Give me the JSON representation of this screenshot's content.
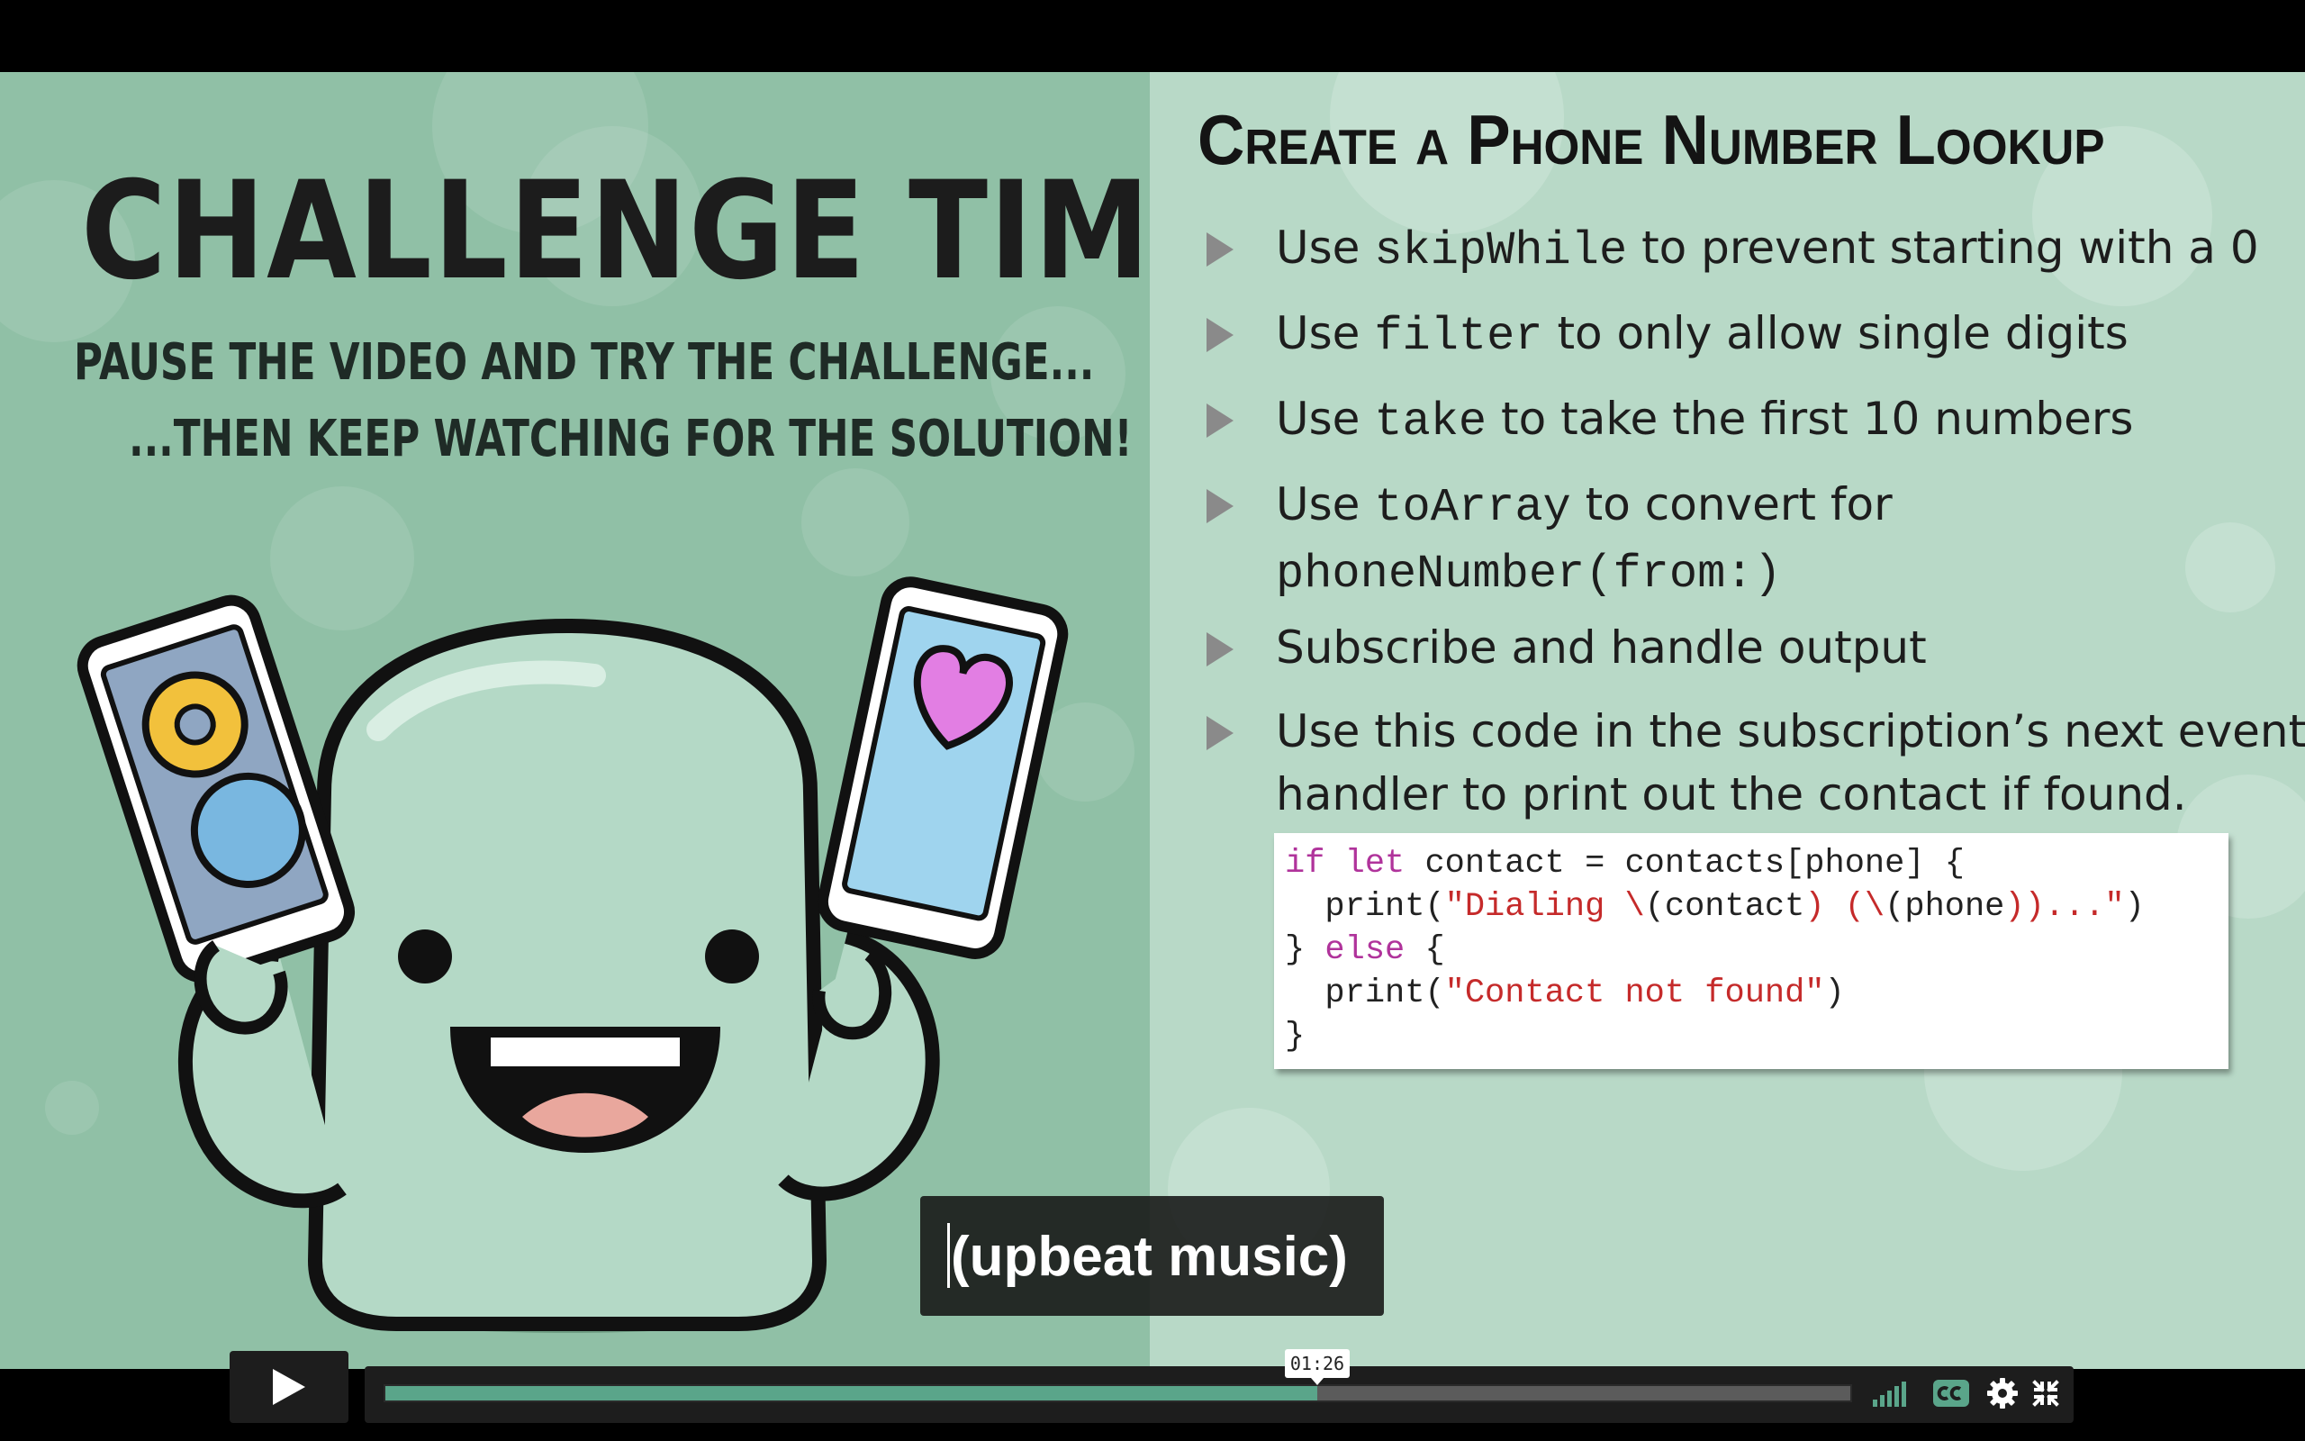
{
  "left_panel": {
    "title": "CHALLENGE TIME!",
    "subtitle_1": "PAUSE THE VIDEO AND TRY THE CHALLENGE...",
    "subtitle_2": "...THEN KEEP WATCHING FOR THE SOLUTION!"
  },
  "slide": {
    "title": "Create a Phone Number Lookup",
    "bullets": [
      {
        "pre": "Use ",
        "code": "skipWhile",
        "post": " to prevent starting with a 0"
      },
      {
        "pre": "Use ",
        "code": "filter",
        "post": " to only allow single digits"
      },
      {
        "pre": "Use ",
        "code": "take",
        "post": " to take the first 10 numbers"
      },
      {
        "pre": "Use ",
        "code": "toArray",
        "post": " to convert for",
        "line2_code": "phoneNumber(from:)"
      },
      {
        "pre": "Subscribe and handle output"
      },
      {
        "pre": "Use this code in the subscription’s next event",
        "line2_text": "handler to print out the contact if found."
      }
    ],
    "code": {
      "l1_kw": "if let",
      "l1_rest": " contact = contacts[phone] {",
      "l2_a": "  print(",
      "l2_s1": "\"Dialing \\",
      "l2_b": "(contact",
      "l2_s2": ") (\\",
      "l2_c": "(phone",
      "l2_s3": "))...\"",
      "l2_d": ")",
      "l3_a": "} ",
      "l3_kw": "else",
      "l3_b": " {",
      "l4_a": "  print(",
      "l4_s": "\"Contact not found\"",
      "l4_b": ")",
      "l5": "}"
    }
  },
  "caption": {
    "text": "(upbeat music)"
  },
  "player": {
    "current_time": "01:26",
    "progress": 0.636,
    "icons": [
      "play-icon",
      "volume-icon",
      "cc-icon",
      "settings-icon",
      "fullscreen-icon"
    ],
    "accent_color": "#5aa58a"
  }
}
